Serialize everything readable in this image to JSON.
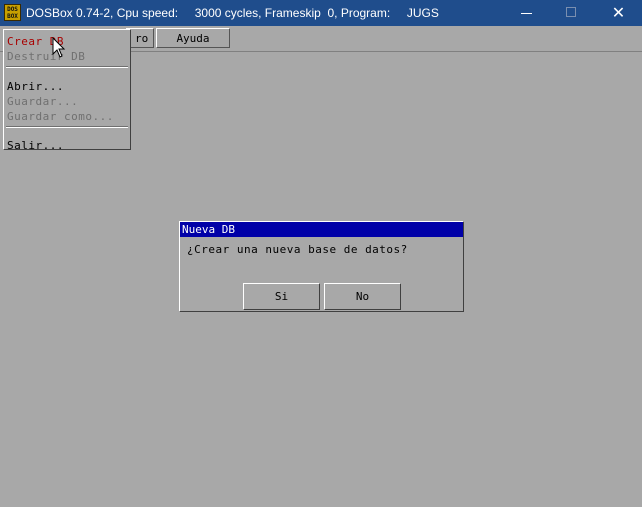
{
  "window": {
    "title": "DOSBox 0.74-2, Cpu speed:     3000 cycles, Frameskip  0, Program:     JUGS",
    "icon_text": "DOS BOX",
    "close_glyph": "✕"
  },
  "menubar": {
    "items": [
      {
        "label": "ro",
        "state": "partially-hidden"
      },
      {
        "label": "Ayuda"
      }
    ]
  },
  "dropdown": {
    "items": [
      {
        "label": "Crear DB",
        "state": "highlighted"
      },
      {
        "label": "Destruir DB",
        "state": "disabled"
      },
      {
        "label": "Abrir...",
        "state": "enabled"
      },
      {
        "label": "Guardar...",
        "state": "disabled"
      },
      {
        "label": "Guardar como...",
        "state": "disabled"
      },
      {
        "label": "Salir...",
        "state": "enabled"
      }
    ]
  },
  "dialog": {
    "title": "Nueva DB",
    "message": "¿Crear una nueva base de datos?",
    "buttons": {
      "yes": "Si",
      "no": "No"
    }
  },
  "colors": {
    "titlebar": "#1f4d8c",
    "background": "#a8a8a8",
    "dialog_title": "#0000a8",
    "highlight_text": "#a80000"
  }
}
